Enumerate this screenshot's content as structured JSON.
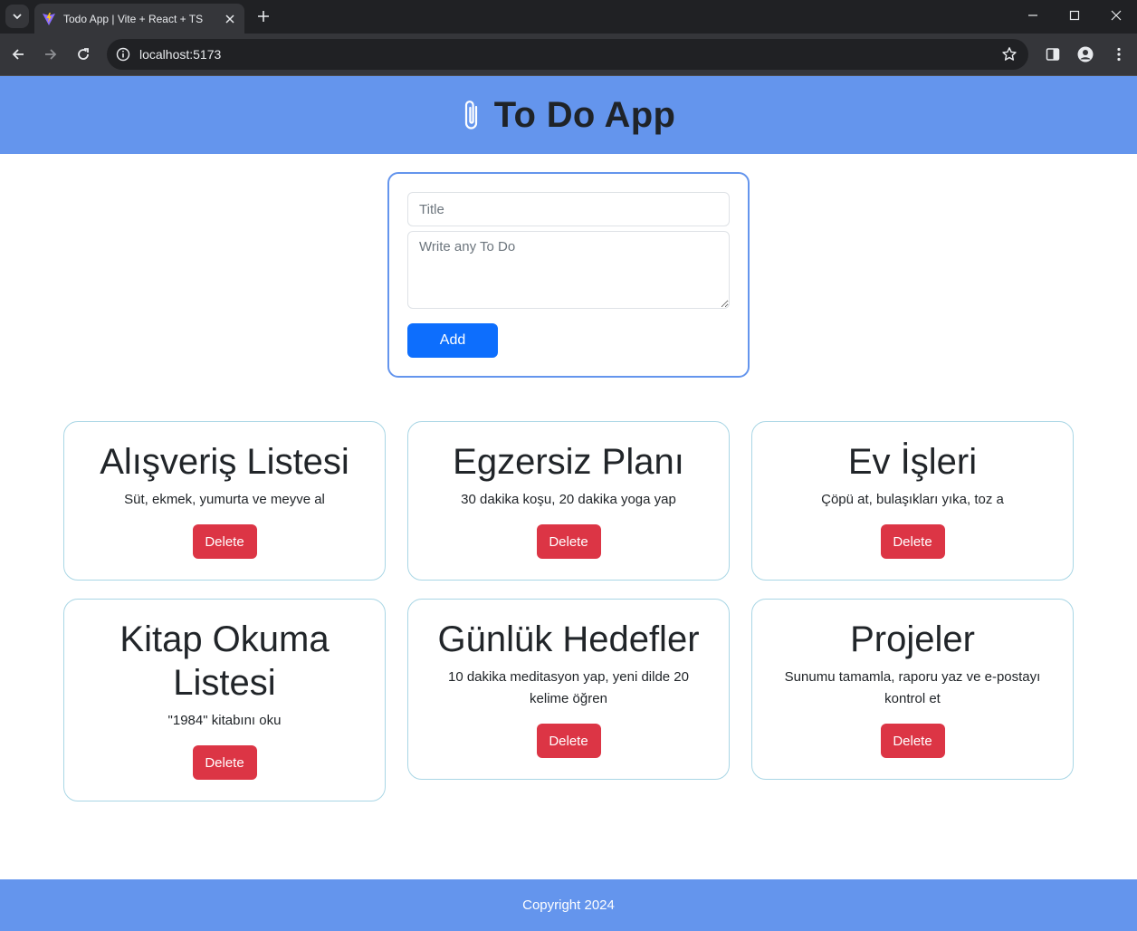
{
  "browser": {
    "tab_title": "Todo App | Vite + React + TS",
    "url": "localhost:5173",
    "icons": {
      "tab_search": "chevron-down-icon",
      "favicon": "vite-logo-icon",
      "tab_close": "close-icon",
      "new_tab": "plus-icon",
      "back": "arrow-left-icon",
      "forward": "arrow-right-icon",
      "reload": "reload-icon",
      "site_info": "info-icon",
      "bookmark": "star-icon",
      "side_panel": "side-panel-icon",
      "profile": "profile-icon",
      "menu": "more-vert-icon"
    }
  },
  "header": {
    "title": "To Do App",
    "icon": "paperclip-icon",
    "background": "#6495ed"
  },
  "form": {
    "title_placeholder": "Title",
    "title_value": "",
    "todo_placeholder": "Write any To Do",
    "todo_value": "",
    "add_label": "Add"
  },
  "todos": [
    {
      "title": "Alışveriş Listesi",
      "description": "Süt, ekmek, yumurta ve meyve al",
      "delete_label": "Delete"
    },
    {
      "title": "Egzersiz Planı",
      "description": "30 dakika koşu, 20 dakika yoga yap",
      "delete_label": "Delete"
    },
    {
      "title": "Ev İşleri",
      "description": "Çöpü at, bulaşıkları yıka, toz a",
      "delete_label": "Delete"
    },
    {
      "title": "Kitap Okuma Listesi",
      "description": "\"1984\" kitabını oku",
      "delete_label": "Delete"
    },
    {
      "title": "Günlük Hedefler",
      "description": "10 dakika meditasyon yap, yeni dilde 20 kelime öğren",
      "delete_label": "Delete"
    },
    {
      "title": "Projeler",
      "description": "Sunumu tamamla, raporu yaz ve e-postayı kontrol et",
      "delete_label": "Delete"
    }
  ],
  "footer": {
    "text": "Copyright 2024"
  },
  "colors": {
    "accent": "#6495ed",
    "primary_button": "#0d6efd",
    "danger_button": "#dc3545",
    "card_border": "#a9d6e5"
  }
}
